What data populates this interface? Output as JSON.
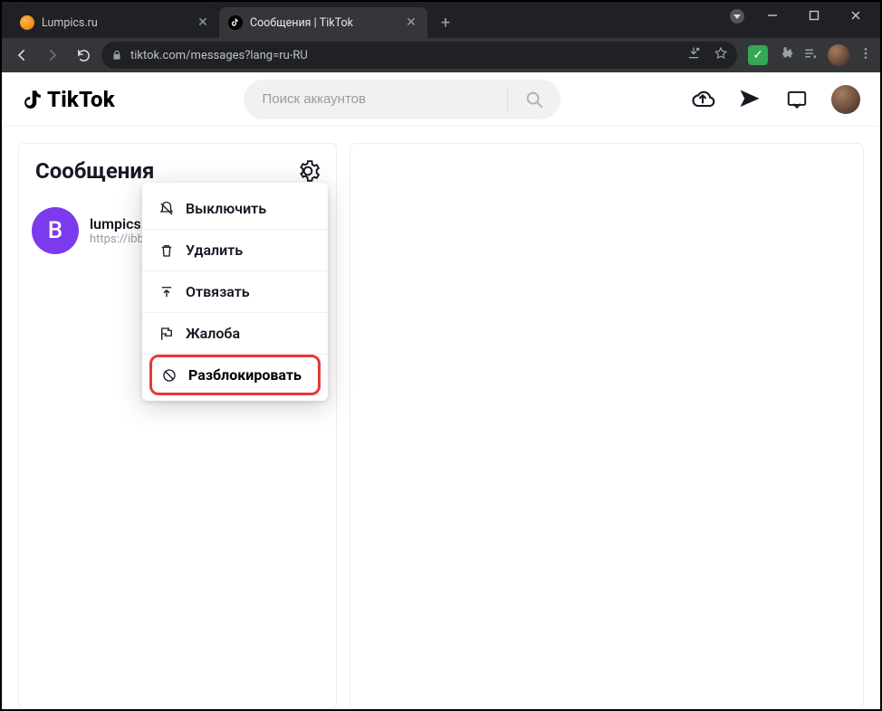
{
  "browser": {
    "tabs": [
      {
        "title": "Lumpics.ru",
        "active": false
      },
      {
        "title": "Сообщения | TikTok",
        "active": true
      }
    ],
    "url": "tiktok.com/messages?lang=ru-RU"
  },
  "tiktok": {
    "logo_text": "TikTok",
    "search_placeholder": "Поиск аккаунтов"
  },
  "sidebar": {
    "title": "Сообщения",
    "conversation": {
      "avatar_letter": "В",
      "name": "lumpics.ru",
      "subtitle": "https://ibb.co/vCFMyQg 10.5.2021",
      "more": "•••"
    }
  },
  "menu": {
    "mute": "Выключить",
    "delete": "Удалить",
    "unpin": "Отвязать",
    "report": "Жалоба",
    "unblock": "Разблокировать"
  }
}
